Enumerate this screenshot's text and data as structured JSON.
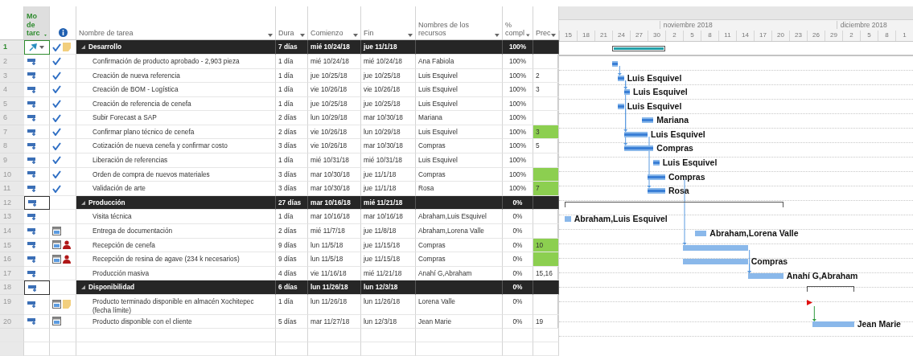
{
  "columns": {
    "mode": "Mo de tarc",
    "name": "Nombre de tarea",
    "duration": "Dura",
    "start": "Comienzo",
    "finish": "Fin",
    "resources": "Nombres de los recursos",
    "percent": "% compl",
    "predecessors": "Prec"
  },
  "timeline": {
    "months": [
      "noviembre 2018",
      "diciembre 2018"
    ],
    "days": [
      "15",
      "18",
      "21",
      "24",
      "27",
      "30",
      "2",
      "5",
      "8",
      "11",
      "14",
      "17",
      "20",
      "23",
      "26",
      "29",
      "2",
      "5",
      "8",
      "1"
    ]
  },
  "tasks": [
    {
      "id": "1",
      "kind": "summary",
      "mode": {
        "kind": "manual"
      },
      "selected": true,
      "indicators": [
        {
          "kind": "check"
        },
        {
          "kind": "note"
        }
      ],
      "name": "Desarrollo",
      "duration": "7 días",
      "start": "mié 10/24/18",
      "finish": "jue 11/1/18",
      "percent": "100%",
      "pred_highlight": false,
      "done": true,
      "gantt": {
        "kind": "summary"
      }
    },
    {
      "id": "2",
      "kind": "task",
      "mode": {
        "kind": "auto"
      },
      "selected": false,
      "indicators": [
        {
          "kind": "check"
        }
      ],
      "name": "Confirmación de producto aprobado - 2,903 pieza",
      "duration": "1 día",
      "start": "mié 10/24/18",
      "finish": "mié 10/24/18",
      "resources": "Ana Fabiola",
      "percent": "100%",
      "pred_highlight": false,
      "done": true,
      "gantt": {
        "kind": "bar"
      }
    },
    {
      "id": "3",
      "kind": "task",
      "mode": {
        "kind": "auto"
      },
      "selected": false,
      "indicators": [
        {
          "kind": "check"
        }
      ],
      "name": "Creación de nueva referencia",
      "duration": "1 día",
      "start": "jue 10/25/18",
      "finish": "jue 10/25/18",
      "resources": "Luis Esquivel",
      "percent": "100%",
      "predecessors": "2",
      "pred_highlight": false,
      "done": true,
      "gantt": {
        "kind": "bar"
      },
      "bar_label": "Luis Esquivel"
    },
    {
      "id": "4",
      "kind": "task",
      "mode": {
        "kind": "auto"
      },
      "selected": false,
      "indicators": [
        {
          "kind": "check"
        }
      ],
      "name": "Creación de BOM - Logística",
      "duration": "1 día",
      "start": "vie 10/26/18",
      "finish": "vie 10/26/18",
      "resources": "Luis Esquivel",
      "percent": "100%",
      "predecessors": "3",
      "pred_highlight": false,
      "done": true,
      "gantt": {
        "kind": "bar"
      },
      "bar_label": "Luis Esquivel"
    },
    {
      "id": "5",
      "kind": "task",
      "mode": {
        "kind": "auto"
      },
      "selected": false,
      "indicators": [
        {
          "kind": "check"
        }
      ],
      "name": "Creación de referencia de cenefa",
      "duration": "1 día",
      "start": "jue 10/25/18",
      "finish": "jue 10/25/18",
      "resources": "Luis Esquivel",
      "percent": "100%",
      "pred_highlight": false,
      "done": true,
      "gantt": {
        "kind": "bar"
      },
      "bar_label": "Luis Esquivel"
    },
    {
      "id": "6",
      "kind": "task",
      "mode": {
        "kind": "auto"
      },
      "selected": false,
      "indicators": [
        {
          "kind": "check"
        }
      ],
      "name": "Subir Forecast a SAP",
      "duration": "2 días",
      "start": "lun 10/29/18",
      "finish": "mar 10/30/18",
      "resources": "Mariana",
      "percent": "100%",
      "pred_highlight": false,
      "done": true,
      "gantt": {
        "kind": "bar"
      },
      "bar_label": "Mariana"
    },
    {
      "id": "7",
      "kind": "task",
      "mode": {
        "kind": "auto"
      },
      "selected": false,
      "indicators": [
        {
          "kind": "check"
        }
      ],
      "name": "Confirmar plano técnico de cenefa",
      "duration": "2 días",
      "start": "vie 10/26/18",
      "finish": "lun 10/29/18",
      "resources": "Luis Esquivel",
      "percent": "100%",
      "predecessors": "3",
      "pred_highlight": true,
      "done": true,
      "gantt": {
        "kind": "bar"
      },
      "bar_label": "Luis Esquivel"
    },
    {
      "id": "8",
      "kind": "task",
      "mode": {
        "kind": "auto"
      },
      "selected": false,
      "indicators": [
        {
          "kind": "check"
        }
      ],
      "name": "Cotización de nueva cenefa y confirmar costo",
      "duration": "3 días",
      "start": "vie 10/26/18",
      "finish": "mar 10/30/18",
      "resources": "Compras",
      "percent": "100%",
      "predecessors": "5",
      "pred_highlight": false,
      "done": true,
      "gantt": {
        "kind": "bar"
      },
      "bar_label": "Compras"
    },
    {
      "id": "9",
      "kind": "task",
      "mode": {
        "kind": "auto"
      },
      "selected": false,
      "indicators": [
        {
          "kind": "check"
        }
      ],
      "name": "Liberación de referencias",
      "duration": "1 día",
      "start": "mié 10/31/18",
      "finish": "mié 10/31/18",
      "resources": "Luis Esquivel",
      "percent": "100%",
      "pred_highlight": false,
      "done": true,
      "gantt": {
        "kind": "bar"
      },
      "bar_label": "Luis Esquivel"
    },
    {
      "id": "10",
      "kind": "task",
      "mode": {
        "kind": "auto"
      },
      "selected": false,
      "indicators": [
        {
          "kind": "check"
        }
      ],
      "name": "Orden de compra de nuevos materiales",
      "duration": "3 días",
      "start": "mar 10/30/18",
      "finish": "jue 11/1/18",
      "resources": "Compras",
      "percent": "100%",
      "pred_highlight": true,
      "done": true,
      "gantt": {
        "kind": "bar"
      },
      "bar_label": "Compras"
    },
    {
      "id": "11",
      "kind": "task",
      "mode": {
        "kind": "auto"
      },
      "selected": false,
      "indicators": [
        {
          "kind": "check"
        }
      ],
      "name": "Validación de arte",
      "duration": "3 días",
      "start": "mar 10/30/18",
      "finish": "jue 11/1/18",
      "resources": "Rosa",
      "percent": "100%",
      "predecessors": "7",
      "pred_highlight": true,
      "done": true,
      "gantt": {
        "kind": "bar"
      },
      "bar_label": "Rosa"
    },
    {
      "id": "12",
      "kind": "summary",
      "mode": {
        "kind": "auto"
      },
      "selected": false,
      "name": "Producción",
      "duration": "27 días",
      "start": "mar 10/16/18",
      "finish": "mié 11/21/18",
      "percent": "0%",
      "pred_highlight": false,
      "done": false,
      "gantt": {
        "kind": "summary"
      }
    },
    {
      "id": "13",
      "kind": "task",
      "mode": {
        "kind": "auto"
      },
      "selected": false,
      "name": "Visita técnica",
      "duration": "1 día",
      "start": "mar 10/16/18",
      "finish": "mar 10/16/18",
      "resources": "Abraham,Luis Esquivel",
      "percent": "0%",
      "pred_highlight": false,
      "done": false,
      "gantt": {
        "kind": "bar"
      },
      "bar_label": "Abraham,Luis Esquivel"
    },
    {
      "id": "14",
      "kind": "task",
      "mode": {
        "kind": "auto"
      },
      "selected": false,
      "indicators": [
        {
          "kind": "calendar"
        }
      ],
      "name": "Entrega de documentación",
      "duration": "2 días",
      "start": "mié 11/7/18",
      "finish": "jue 11/8/18",
      "resources": "Abraham,Lorena Valle",
      "percent": "0%",
      "pred_highlight": false,
      "done": false,
      "gantt": {
        "kind": "bar"
      },
      "bar_label": "Abraham,Lorena Valle"
    },
    {
      "id": "15",
      "kind": "task",
      "mode": {
        "kind": "auto"
      },
      "selected": false,
      "indicators": [
        {
          "kind": "calendar"
        },
        {
          "kind": "person"
        }
      ],
      "name": "Recepción de cenefa",
      "duration": "9 días",
      "start": "lun 11/5/18",
      "finish": "jue 11/15/18",
      "resources": "Compras",
      "percent": "0%",
      "predecessors": "10",
      "pred_highlight": true,
      "done": false,
      "gantt": {
        "kind": "bar"
      }
    },
    {
      "id": "16",
      "kind": "task",
      "mode": {
        "kind": "auto"
      },
      "selected": false,
      "indicators": [
        {
          "kind": "calendar"
        },
        {
          "kind": "person"
        }
      ],
      "name": "Recepción de resina de agave (234 k necesarios)",
      "duration": "9 días",
      "start": "lun 11/5/18",
      "finish": "jue 11/15/18",
      "resources": "Compras",
      "percent": "0%",
      "pred_highlight": true,
      "done": false,
      "gantt": {
        "kind": "bar"
      },
      "bar_label": "Compras"
    },
    {
      "id": "17",
      "kind": "task",
      "mode": {
        "kind": "auto"
      },
      "selected": false,
      "name": "Producción masiva",
      "duration": "4 días",
      "start": "vie 11/16/18",
      "finish": "mié 11/21/18",
      "resources": "Anahí G,Abraham",
      "percent": "0%",
      "predecessors": "15,16",
      "pred_highlight": false,
      "done": false,
      "gantt": {
        "kind": "bar"
      },
      "bar_label": "Anahí G,Abraham"
    },
    {
      "id": "18",
      "kind": "summary",
      "mode": {
        "kind": "auto"
      },
      "selected": false,
      "name": "Disponibilidad",
      "duration": "6 días",
      "start": "lun 11/26/18",
      "finish": "lun 12/3/18",
      "percent": "0%",
      "pred_highlight": false,
      "done": false,
      "gantt": {
        "kind": "summary"
      }
    },
    {
      "id": "19",
      "kind": "task",
      "mode": {
        "kind": "auto"
      },
      "selected": false,
      "indicators": [
        {
          "kind": "calendar"
        },
        {
          "kind": "note"
        }
      ],
      "name": "Producto terminado disponible en almacén Xochitepec (fecha límite)",
      "duration": "1 día",
      "start": "lun 11/26/18",
      "finish": "lun 11/26/18",
      "resources": "Lorena Valle",
      "percent": "0%",
      "pred_highlight": false,
      "gantt": {
        "kind": "flag"
      }
    },
    {
      "id": "20",
      "kind": "task",
      "mode": {
        "kind": "auto"
      },
      "selected": false,
      "indicators": [
        {
          "kind": "calendar"
        }
      ],
      "name": "Producto disponible con el cliente",
      "duration": "5 días",
      "start": "mar 11/27/18",
      "finish": "lun 12/3/18",
      "resources": "Jean Marie",
      "percent": "0%",
      "predecessors": "19",
      "pred_highlight": false,
      "done": false,
      "gantt": {
        "kind": "bar"
      },
      "bar_label": "Jean Marie"
    }
  ]
}
